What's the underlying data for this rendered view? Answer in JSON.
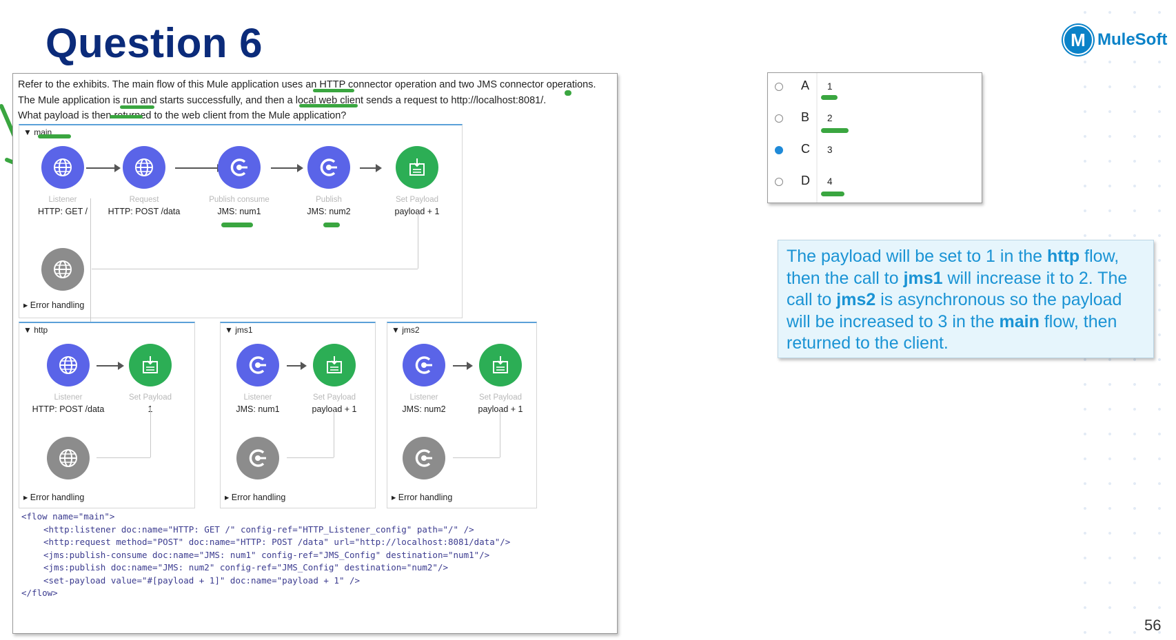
{
  "slide": {
    "title": "Question 6",
    "logo_text": "MuleSoft",
    "logo_mark": "M",
    "page_number": "56"
  },
  "question": {
    "line1": "Refer to the exhibits. The main flow of this Mule application uses an HTTP connector operation and two JMS connector operations.",
    "line2": "The Mule application is run and starts successfully, and then a local web client sends a request to http://localhost:8081/.",
    "line3": "What payload is then returned to the web client from the Mule application?"
  },
  "flows": {
    "main": {
      "name": "main",
      "error_handling": "Error handling",
      "nodes": [
        {
          "label": "Listener",
          "value": "HTTP: GET /",
          "icon": "globe-icon"
        },
        {
          "label": "Request",
          "value": "HTTP: POST /data",
          "icon": "globe-icon"
        },
        {
          "label": "Publish consume",
          "value": "JMS: num1",
          "icon": "jms-icon"
        },
        {
          "label": "Publish",
          "value": "JMS: num2",
          "icon": "jms-icon"
        },
        {
          "label": "Set Payload",
          "value": "payload + 1",
          "icon": "set-payload-icon"
        }
      ]
    },
    "http": {
      "name": "http",
      "error_handling": "Error handling",
      "nodes": [
        {
          "label": "Listener",
          "value": "HTTP: POST /data",
          "icon": "globe-icon"
        },
        {
          "label": "Set Payload",
          "value": "1",
          "icon": "set-payload-icon"
        }
      ]
    },
    "jms1": {
      "name": "jms1",
      "error_handling": "Error handling",
      "nodes": [
        {
          "label": "Listener",
          "value": "JMS: num1",
          "icon": "jms-icon"
        },
        {
          "label": "Set Payload",
          "value": "payload + 1",
          "icon": "set-payload-icon"
        }
      ]
    },
    "jms2": {
      "name": "jms2",
      "error_handling": "Error handling",
      "nodes": [
        {
          "label": "Listener",
          "value": "JMS: num2",
          "icon": "jms-icon"
        },
        {
          "label": "Set Payload",
          "value": "payload + 1",
          "icon": "set-payload-icon"
        }
      ]
    }
  },
  "code": [
    "<flow name=\"main\">",
    "<http:listener doc:name=\"HTTP: GET /\" config-ref=\"HTTP_Listener_config\" path=\"/\" />",
    "<http:request method=\"POST\" doc:name=\"HTTP: POST /data\" url=\"http://localhost:8081/data\"/>",
    "<jms:publish-consume doc:name=\"JMS: num1\" config-ref=\"JMS_Config\" destination=\"num1\"/>",
    "<jms:publish doc:name=\"JMS: num2\" config-ref=\"JMS_Config\" destination=\"num2\"/>",
    "<set-payload value=\"#[payload + 1]\" doc:name=\"payload + 1\" />",
    "</flow>"
  ],
  "choices": [
    {
      "letter": "A",
      "value": "1",
      "selected": false
    },
    {
      "letter": "B",
      "value": "2",
      "selected": false
    },
    {
      "letter": "C",
      "value": "3",
      "selected": true
    },
    {
      "letter": "D",
      "value": "4",
      "selected": false
    }
  ],
  "answer": {
    "t1": "The payload will be set to 1 in the ",
    "b1": "http",
    "t2": " flow, then the call to ",
    "b2": "jms1",
    "t3": " will increase it to 2. The call to ",
    "b3": "jms2",
    "t4": " is asynchronous so the payload will be increased to 3 in the ",
    "b4": "main",
    "t5": " flow, then returned to the client."
  },
  "colors": {
    "title": "#0b2b7a",
    "answer_text": "#1a93d4",
    "answer_bg": "#e6f5fc",
    "node_blue": "#5a64e8",
    "node_green": "#2cae55",
    "node_gray": "#8c8c8c",
    "highlight": "#3aa640"
  }
}
